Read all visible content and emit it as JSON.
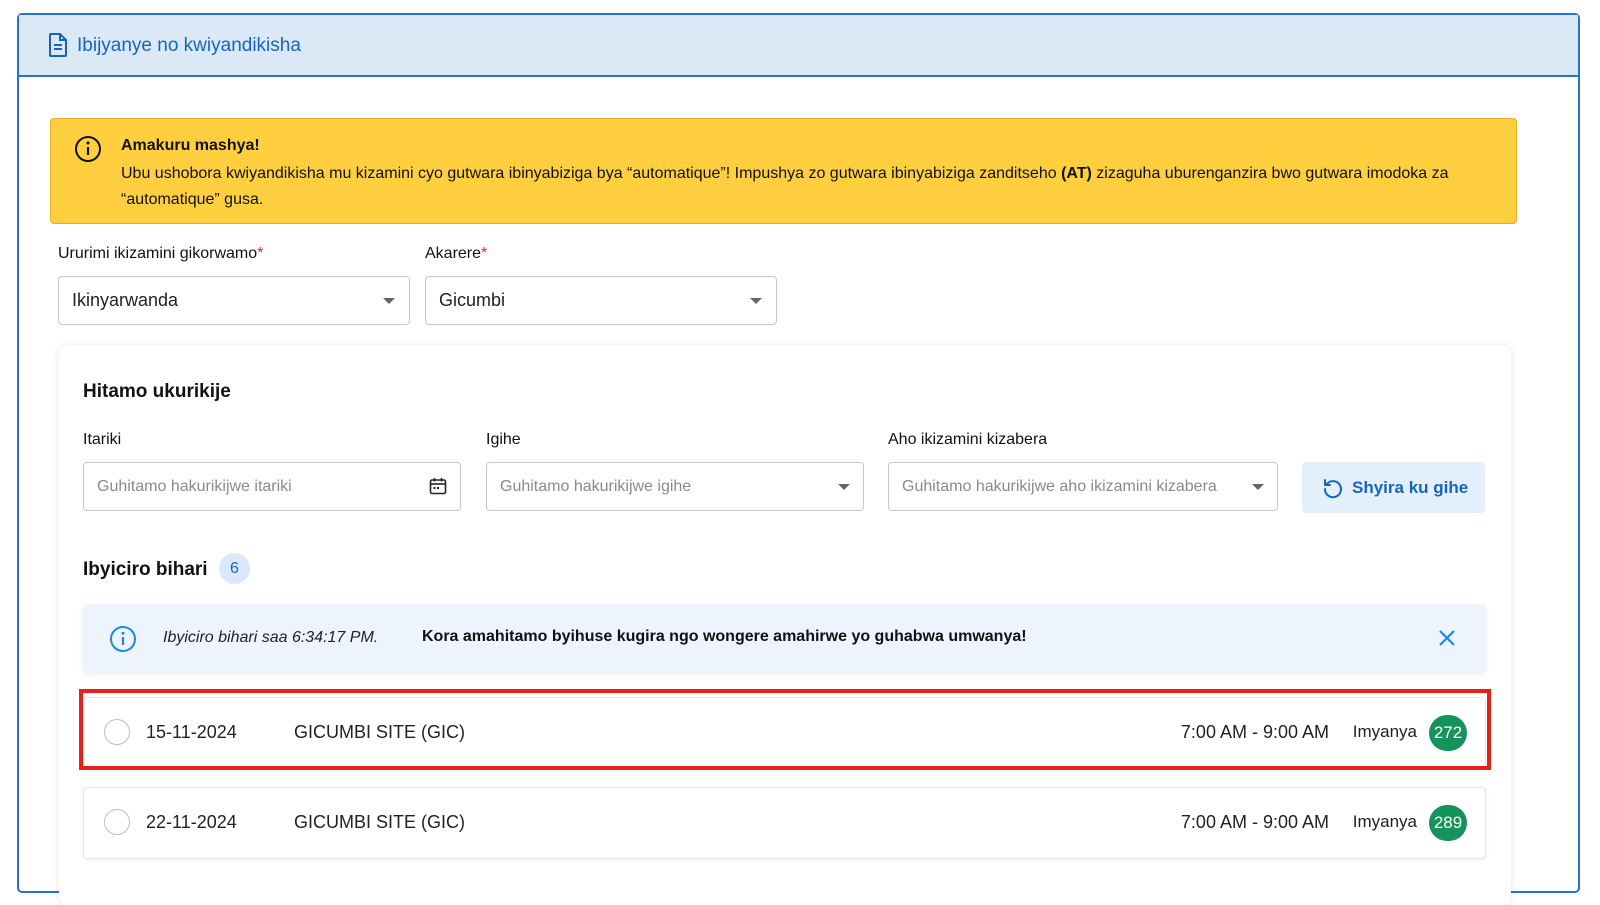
{
  "header": {
    "title": "Ibijyanye no kwiyandikisha",
    "icon": "document-icon"
  },
  "notice": {
    "title": "Amakuru mashya!",
    "body_before": "Ubu ushobora kwiyandikisha mu kizamini cyo gutwara ibinyabiziga bya “automatique”! Impushya zo gutwara ibinyabiziga zanditseho ",
    "body_bold": "(AT)",
    "body_after": " zizaguha uburenganzira bwo gutwara imodoka za “automatique” gusa.",
    "color": "#ffcf3f"
  },
  "language": {
    "label": "Ururimi ikizamini gikorwamo",
    "required_mark": "*",
    "value": "Ikinyarwanda"
  },
  "district": {
    "label": "Akarere",
    "required_mark": "*",
    "value": "Gicumbi"
  },
  "preferences": {
    "title": "Hitamo ukurikije",
    "date": {
      "label": "Itariki",
      "placeholder": "Guhitamo hakurikijwe itariki"
    },
    "time": {
      "label": "Igihe",
      "placeholder": "Guhitamo hakurikijwe igihe"
    },
    "location": {
      "label": "Aho ikizamini kizabera",
      "placeholder": "Guhitamo hakurikijwe aho ikizamini kizabera"
    },
    "reset_label": "Shyira ku gihe"
  },
  "slots": {
    "title": "Ibyiciro bihari",
    "count": "6",
    "info_text": "Ibyiciro bihari saa 6:34:17 PM.",
    "info_cta": "Kora amahitamo byihuse kugira ngo wongere amahirwe yo guhabwa umwanya!",
    "seats_label": "Imyanya",
    "items": [
      {
        "date": "15-11-2024",
        "site": "GICUMBI SITE (GIC)",
        "time": "7:00 AM - 9:00 AM",
        "seats": "272"
      },
      {
        "date": "22-11-2024",
        "site": "GICUMBI SITE (GIC)",
        "time": "7:00 AM - 9:00 AM",
        "seats": "289"
      }
    ]
  },
  "colors": {
    "accent": "#1565c0",
    "border": "#2a6fd6",
    "seats_badge": "#15935a",
    "highlight": "#e8201c"
  }
}
